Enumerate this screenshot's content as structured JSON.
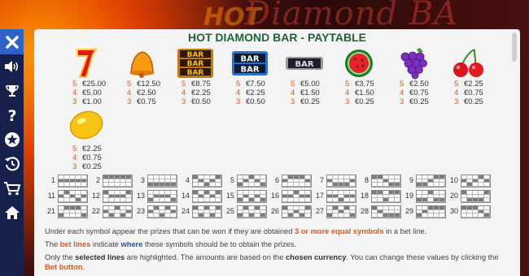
{
  "background": {
    "title_hot": "HOT",
    "title_rest": "Diamond BA"
  },
  "sidebar": {
    "items": [
      {
        "icon": "close-icon"
      },
      {
        "icon": "sound-icon"
      },
      {
        "icon": "trophy-icon"
      },
      {
        "icon": "help-icon"
      },
      {
        "icon": "star-icon"
      },
      {
        "icon": "history-icon"
      },
      {
        "icon": "cart-icon"
      },
      {
        "icon": "home-icon"
      }
    ]
  },
  "paytable": {
    "title": "HOT DIAMOND BAR - PAYTABLE",
    "symbols": [
      {
        "icon": "seven-icon",
        "pays": [
          {
            "n": "5",
            "v": "€25.00"
          },
          {
            "n": "4",
            "v": "€5.00"
          },
          {
            "n": "3",
            "v": "€1.00"
          }
        ]
      },
      {
        "icon": "bell-icon",
        "pays": [
          {
            "n": "5",
            "v": "€12.50"
          },
          {
            "n": "4",
            "v": "€2.50"
          },
          {
            "n": "3",
            "v": "€0.75"
          }
        ]
      },
      {
        "icon": "triple-bar-icon",
        "pays": [
          {
            "n": "5",
            "v": "€8.75"
          },
          {
            "n": "4",
            "v": "€2.25"
          },
          {
            "n": "3",
            "v": "€0.50"
          }
        ]
      },
      {
        "icon": "double-bar-icon",
        "pays": [
          {
            "n": "5",
            "v": "€7.50"
          },
          {
            "n": "4",
            "v": "€2.25"
          },
          {
            "n": "3",
            "v": "€0.50"
          }
        ]
      },
      {
        "icon": "single-bar-icon",
        "pays": [
          {
            "n": "5",
            "v": "€5.00"
          },
          {
            "n": "4",
            "v": "€1.50"
          },
          {
            "n": "3",
            "v": "€0.25"
          }
        ]
      },
      {
        "icon": "watermelon-icon",
        "pays": [
          {
            "n": "5",
            "v": "€3.75"
          },
          {
            "n": "4",
            "v": "€1.50"
          },
          {
            "n": "3",
            "v": "€0.25"
          }
        ]
      },
      {
        "icon": "grapes-icon",
        "pays": [
          {
            "n": "5",
            "v": "€2.50"
          },
          {
            "n": "4",
            "v": "€0.75"
          },
          {
            "n": "3",
            "v": "€0.25"
          }
        ]
      },
      {
        "icon": "cherries-icon",
        "pays": [
          {
            "n": "5",
            "v": "€2.25"
          },
          {
            "n": "4",
            "v": "€0.75"
          },
          {
            "n": "3",
            "v": "€0.25"
          }
        ]
      },
      {
        "icon": "lemon-icon",
        "pays": [
          {
            "n": "5",
            "v": "€2.25"
          },
          {
            "n": "4",
            "v": "€0.75"
          },
          {
            "n": "3",
            "v": "€0.25"
          }
        ]
      }
    ],
    "bet_lines": [
      {
        "n": "1",
        "rows": [
          1,
          1,
          1,
          1,
          1
        ]
      },
      {
        "n": "2",
        "rows": [
          0,
          0,
          0,
          0,
          0
        ]
      },
      {
        "n": "3",
        "rows": [
          2,
          2,
          2,
          2,
          2
        ]
      },
      {
        "n": "4",
        "rows": [
          0,
          1,
          2,
          1,
          0
        ]
      },
      {
        "n": "5",
        "rows": [
          2,
          1,
          0,
          1,
          2
        ]
      },
      {
        "n": "6",
        "rows": [
          1,
          0,
          0,
          0,
          1
        ]
      },
      {
        "n": "7",
        "rows": [
          1,
          2,
          2,
          2,
          1
        ]
      },
      {
        "n": "8",
        "rows": [
          0,
          0,
          1,
          2,
          2
        ]
      },
      {
        "n": "9",
        "rows": [
          2,
          2,
          1,
          0,
          0
        ]
      },
      {
        "n": "10",
        "rows": [
          1,
          2,
          1,
          0,
          1
        ]
      },
      {
        "n": "11",
        "rows": [
          1,
          0,
          1,
          2,
          1
        ]
      },
      {
        "n": "12",
        "rows": [
          0,
          1,
          1,
          1,
          0
        ]
      },
      {
        "n": "13",
        "rows": [
          2,
          1,
          1,
          1,
          2
        ]
      },
      {
        "n": "14",
        "rows": [
          0,
          1,
          0,
          1,
          0
        ]
      },
      {
        "n": "15",
        "rows": [
          2,
          1,
          2,
          1,
          2
        ]
      },
      {
        "n": "16",
        "rows": [
          1,
          1,
          0,
          1,
          1
        ]
      },
      {
        "n": "17",
        "rows": [
          1,
          1,
          2,
          1,
          1
        ]
      },
      {
        "n": "18",
        "rows": [
          0,
          0,
          2,
          0,
          0
        ]
      },
      {
        "n": "19",
        "rows": [
          2,
          2,
          0,
          2,
          2
        ]
      },
      {
        "n": "20",
        "rows": [
          0,
          2,
          2,
          2,
          0
        ]
      },
      {
        "n": "21",
        "rows": [
          2,
          0,
          0,
          0,
          2
        ]
      },
      {
        "n": "22",
        "rows": [
          1,
          2,
          0,
          2,
          1
        ]
      },
      {
        "n": "23",
        "rows": [
          1,
          0,
          2,
          0,
          1
        ]
      },
      {
        "n": "24",
        "rows": [
          0,
          2,
          0,
          2,
          0
        ]
      },
      {
        "n": "25",
        "rows": [
          2,
          0,
          2,
          0,
          2
        ]
      },
      {
        "n": "26",
        "rows": [
          0,
          2,
          1,
          2,
          0
        ]
      },
      {
        "n": "27",
        "rows": [
          2,
          0,
          1,
          0,
          2
        ]
      },
      {
        "n": "28",
        "rows": [
          0,
          1,
          2,
          2,
          2
        ]
      },
      {
        "n": "29",
        "rows": [
          2,
          1,
          0,
          0,
          0
        ]
      },
      {
        "n": "30",
        "rows": [
          0,
          0,
          0,
          1,
          2
        ]
      }
    ],
    "info": {
      "p1": {
        "a": "Under each symbol appear the prizes that can be won if they are obtained ",
        "b": "3 or more equal symbols",
        "c": " in a bet line."
      },
      "p2": {
        "a": "The ",
        "b": "bet lines",
        "c": " indicate ",
        "d": "where",
        "e": " these symbols should be to obtain the prizes."
      },
      "p3": {
        "a": "Only the ",
        "b": "selected lines",
        "c": " are highlighted. The amounts are based on the ",
        "d": "chosen currency",
        "e": ". You can change these values by clicking the ",
        "f": "Bet button",
        "g": "."
      }
    }
  },
  "colors": {
    "title": "#23613a",
    "accent": "#e05a1a",
    "link": "#2a4fa8",
    "sidebar": "#16204a",
    "close": "#2f62c9"
  }
}
